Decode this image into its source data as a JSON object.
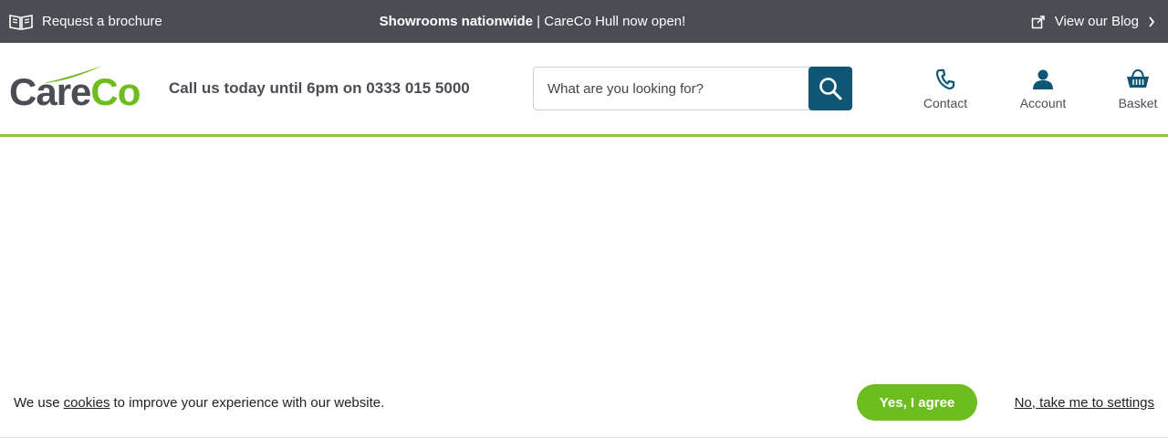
{
  "topbar": {
    "brochure_label": "Request a brochure",
    "brochure_icon": "book-icon",
    "announcement_bold": "Showrooms nationwide",
    "announcement_rest": " | CareCo Hull now open!",
    "blog_label": "View our Blog",
    "blog_icon": "external-link-icon",
    "background": "#4a4e54"
  },
  "header": {
    "logo": {
      "part1": "Care",
      "part2": "Co",
      "color_dark": "#4a4e54",
      "color_green": "#6cbd1d"
    },
    "phone_text": "Call us today until 6pm on 0333 015 5000",
    "search": {
      "placeholder": "What are you looking for?",
      "value": "",
      "button_icon": "search-icon",
      "button_color": "#0f5574"
    },
    "nav": [
      {
        "label": "Contact",
        "icon": "phone-icon"
      },
      {
        "label": "Account",
        "icon": "user-icon"
      },
      {
        "label": "Basket",
        "icon": "basket-icon"
      }
    ],
    "accent_border": "#8bc34a"
  },
  "cookie_banner": {
    "text_before": "We use",
    "link": "cookies",
    "text_after": "to improve your experience with our website.",
    "agree_label": "Yes, I agree",
    "settings_label": "No, take me to settings",
    "agree_color": "#6cbd1d"
  }
}
